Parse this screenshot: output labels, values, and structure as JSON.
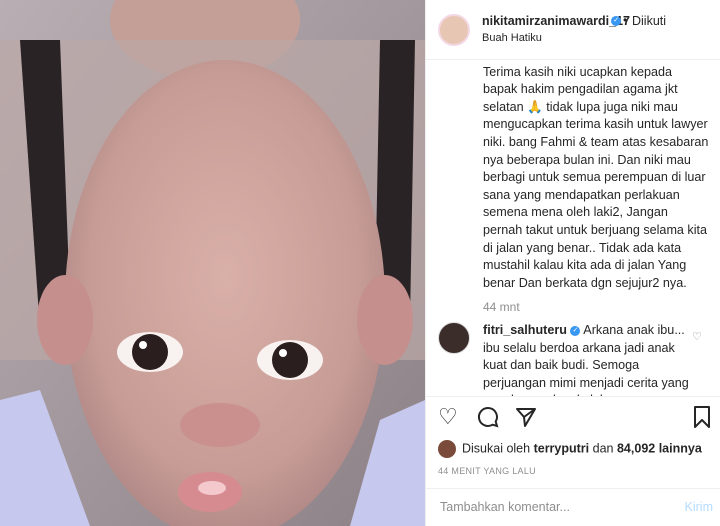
{
  "post": {
    "username": "nikitamirzanimawardi_17",
    "dot": "•",
    "follow_label": "Diikuti",
    "location": "Buah Hatiku",
    "caption": "kabulkan.\nTerima kasih niki ucapkan kepada bapak hakim pengadilan agama jkt selatan 🙏 tidak lupa juga niki mau mengucapkan terima kasih untuk lawyer niki. bang Fahmi & team atas kesabaran nya beberapa bulan ini. Dan niki mau berbagi untuk semua perempuan di luar sana yang mendapatkan perlakuan semena mena oleh laki2, Jangan pernah takut untuk berjuang selama kita di jalan yang benar.. Tidak ada kata mustahil kalau kita ada di jalan Yang benar Dan berkata dgn sejujur2 nya.",
    "caption_time": "44 mnt"
  },
  "comment": {
    "username": "fitri_salhuteru",
    "text": "Arkana anak ibu... ibu selalu berdoa arkana jadi anak kuat dan baik budi. Semoga perjuangan mimi menjadi cerita yang membanggakan kelak"
  },
  "likes": {
    "prefix": "Disukai oleh",
    "user": "terryputri",
    "and": "dan",
    "count": "84,092",
    "suffix": "lainnya"
  },
  "timestamp": "44 MENIT YANG LALU",
  "add_comment": {
    "placeholder": "Tambahkan komentar...",
    "post_label": "Kirim"
  },
  "icons": {
    "like": "heart-icon",
    "comment": "comment-icon",
    "share": "share-icon",
    "save": "bookmark-icon"
  }
}
